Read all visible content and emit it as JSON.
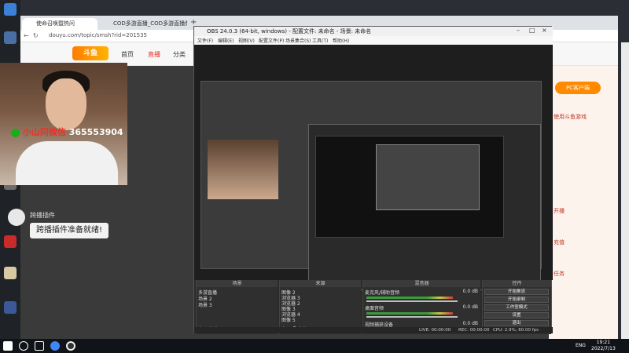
{
  "browser": {
    "tabs": [
      {
        "label": "使命召唤暨热问"
      },
      {
        "label": "COD多游直播_COD多游直播频..."
      }
    ],
    "url": "douyu.com/topic/smsh?rid=201535",
    "nav": [
      "首页",
      "直播",
      "分类"
    ],
    "logo_text": "斗鱼"
  },
  "overlay": {
    "wechat_label": "小山同微信",
    "wechat_number": "365553904"
  },
  "chat": {
    "name": "跨播插件",
    "message": "跨播插件准备就绪!"
  },
  "right_panel": {
    "pc_button": "PC客户端",
    "lines": [
      "使用斗鱼游戏",
      "开播",
      "充值",
      "任务"
    ]
  },
  "obs": {
    "title": "OBS 24.0.3 (64-bit, windows) - 配置文件: 未命名 - 场景: 未命名",
    "menu": [
      "文件(F)",
      "编辑(E)",
      "视图(V)",
      "配置文件(P)",
      "场景集合(S)",
      "工具(T)",
      "帮助(H)"
    ],
    "panels": {
      "scenes_title": "场景",
      "sources_title": "来源",
      "mixer_title": "混音器",
      "controls_title": "控件"
    },
    "scenes": [
      "多游直播",
      "场景 2",
      "场景 3"
    ],
    "sources": [
      "图像 2",
      "浏览器 3",
      "浏览器 2",
      "图像 3",
      "浏览器 4",
      "图像 5"
    ],
    "mixer": [
      {
        "name": "麦克风/辅助音频",
        "level": "0.0 dB"
      },
      {
        "name": "桌面音频",
        "level": "0.0 dB"
      },
      {
        "name": "视频捕获设备",
        "level": "0.0 dB"
      }
    ],
    "controls": [
      "开始推流",
      "开始录制",
      "工作室模式",
      "设置",
      "退出"
    ],
    "status": {
      "live": "LIVE: 00:00:00",
      "rec": "REC: 00:00:00",
      "cpu": "CPU: 2.9%, 60.00 fps"
    }
  },
  "taskbar": {
    "time": "19:21",
    "date": "2022/7/13",
    "lang": "ENG"
  }
}
